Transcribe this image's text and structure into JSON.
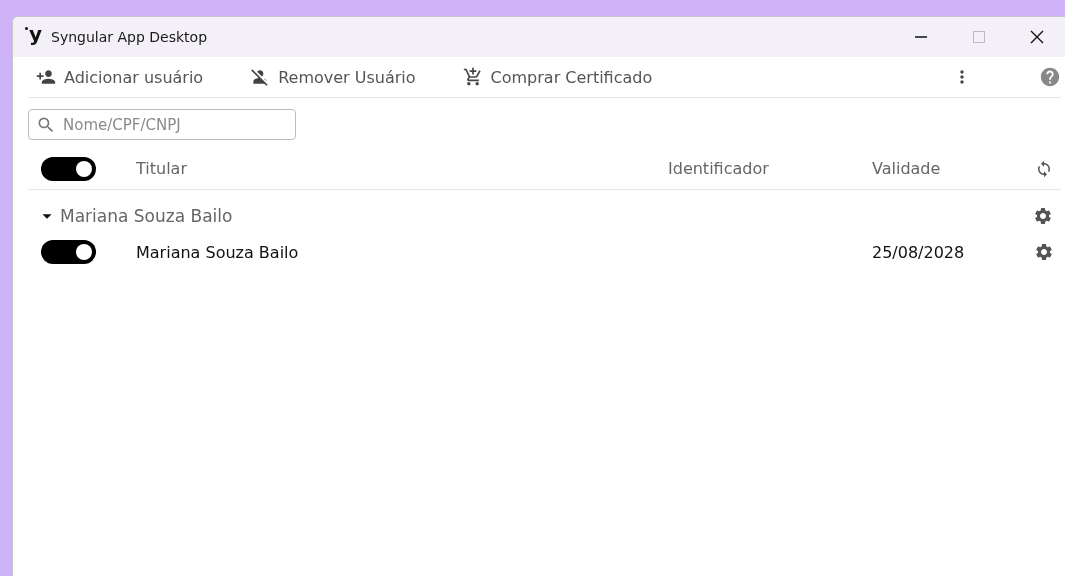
{
  "window": {
    "logo": "y",
    "title": "Syngular App Desktop"
  },
  "toolbar": {
    "actions": [
      {
        "kind": "add-user",
        "label": "Adicionar usuário"
      },
      {
        "kind": "remove-user",
        "label": "Remover Usuário"
      },
      {
        "kind": "cart",
        "label": "Comprar Certificado"
      }
    ]
  },
  "search": {
    "placeholder": "Nome/CPF/CNPJ"
  },
  "table": {
    "select_all": {
      "on": true
    },
    "columns": [
      "Titular",
      "Identificador",
      "Validade"
    ],
    "groups": [
      {
        "name": "Mariana Souza Bailo",
        "expanded": true,
        "children": [
          {
            "on": true,
            "titular": "Mariana Souza Bailo",
            "validade": "25/08/2028"
          }
        ]
      }
    ]
  }
}
